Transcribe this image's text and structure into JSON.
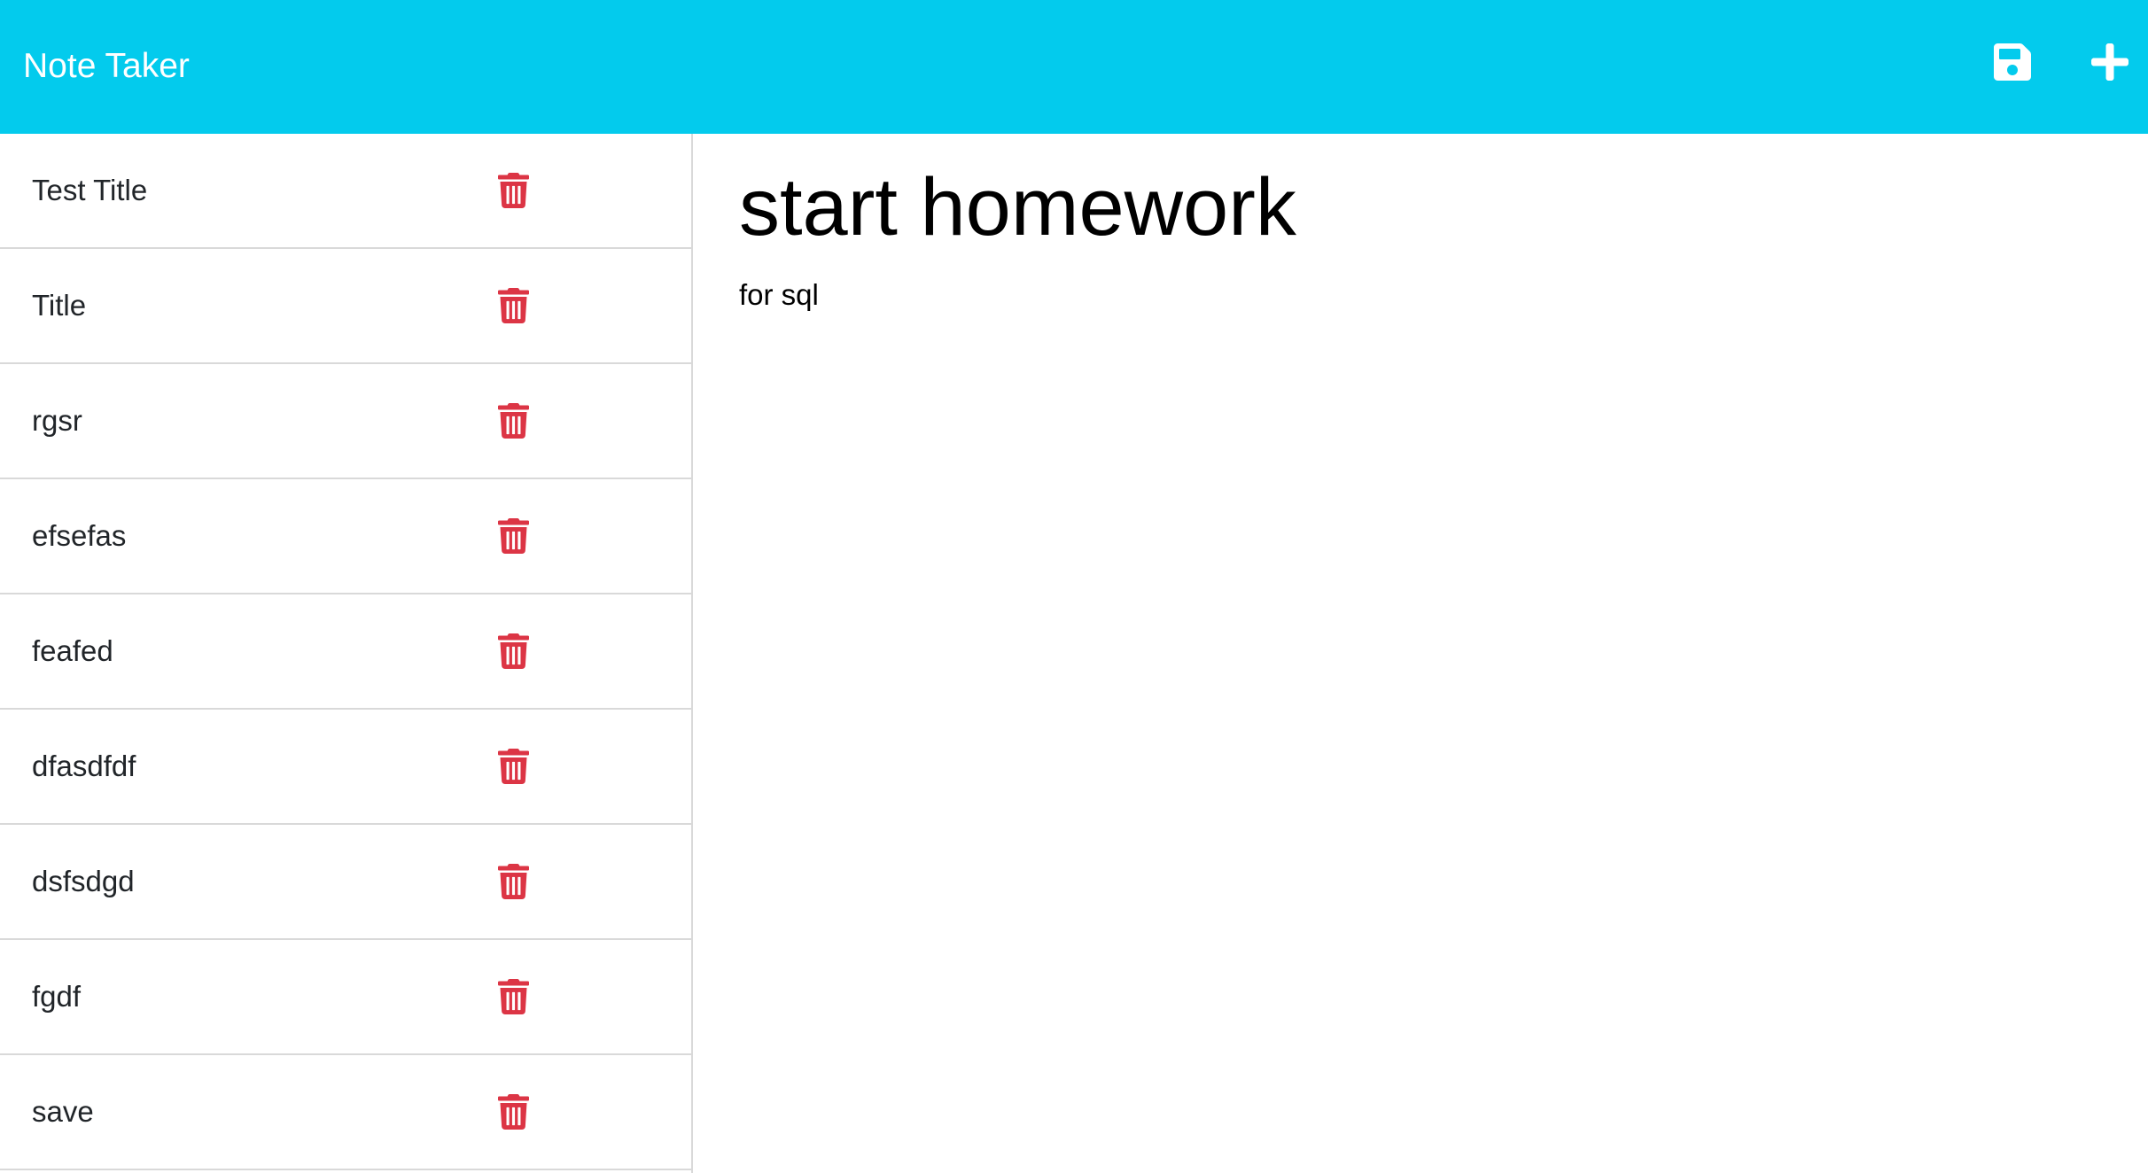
{
  "app": {
    "title": "Note Taker"
  },
  "toolbar": {
    "save_icon": "floppy-disk-icon",
    "new_icon": "plus-icon",
    "icon_color": "#ffffff"
  },
  "theme": {
    "header_bg": "#03cbed",
    "delete_color": "#dc3545"
  },
  "notes": {
    "items": [
      {
        "title": "Test Title"
      },
      {
        "title": "Title"
      },
      {
        "title": "rgsr"
      },
      {
        "title": "efsefas"
      },
      {
        "title": "feafed"
      },
      {
        "title": "dfasdfdf"
      },
      {
        "title": "dsfsdgd"
      },
      {
        "title": "fgdf"
      },
      {
        "title": "save"
      }
    ],
    "delete_icon": "trash-icon"
  },
  "active_note": {
    "title": "start homework",
    "text": "for sql"
  }
}
